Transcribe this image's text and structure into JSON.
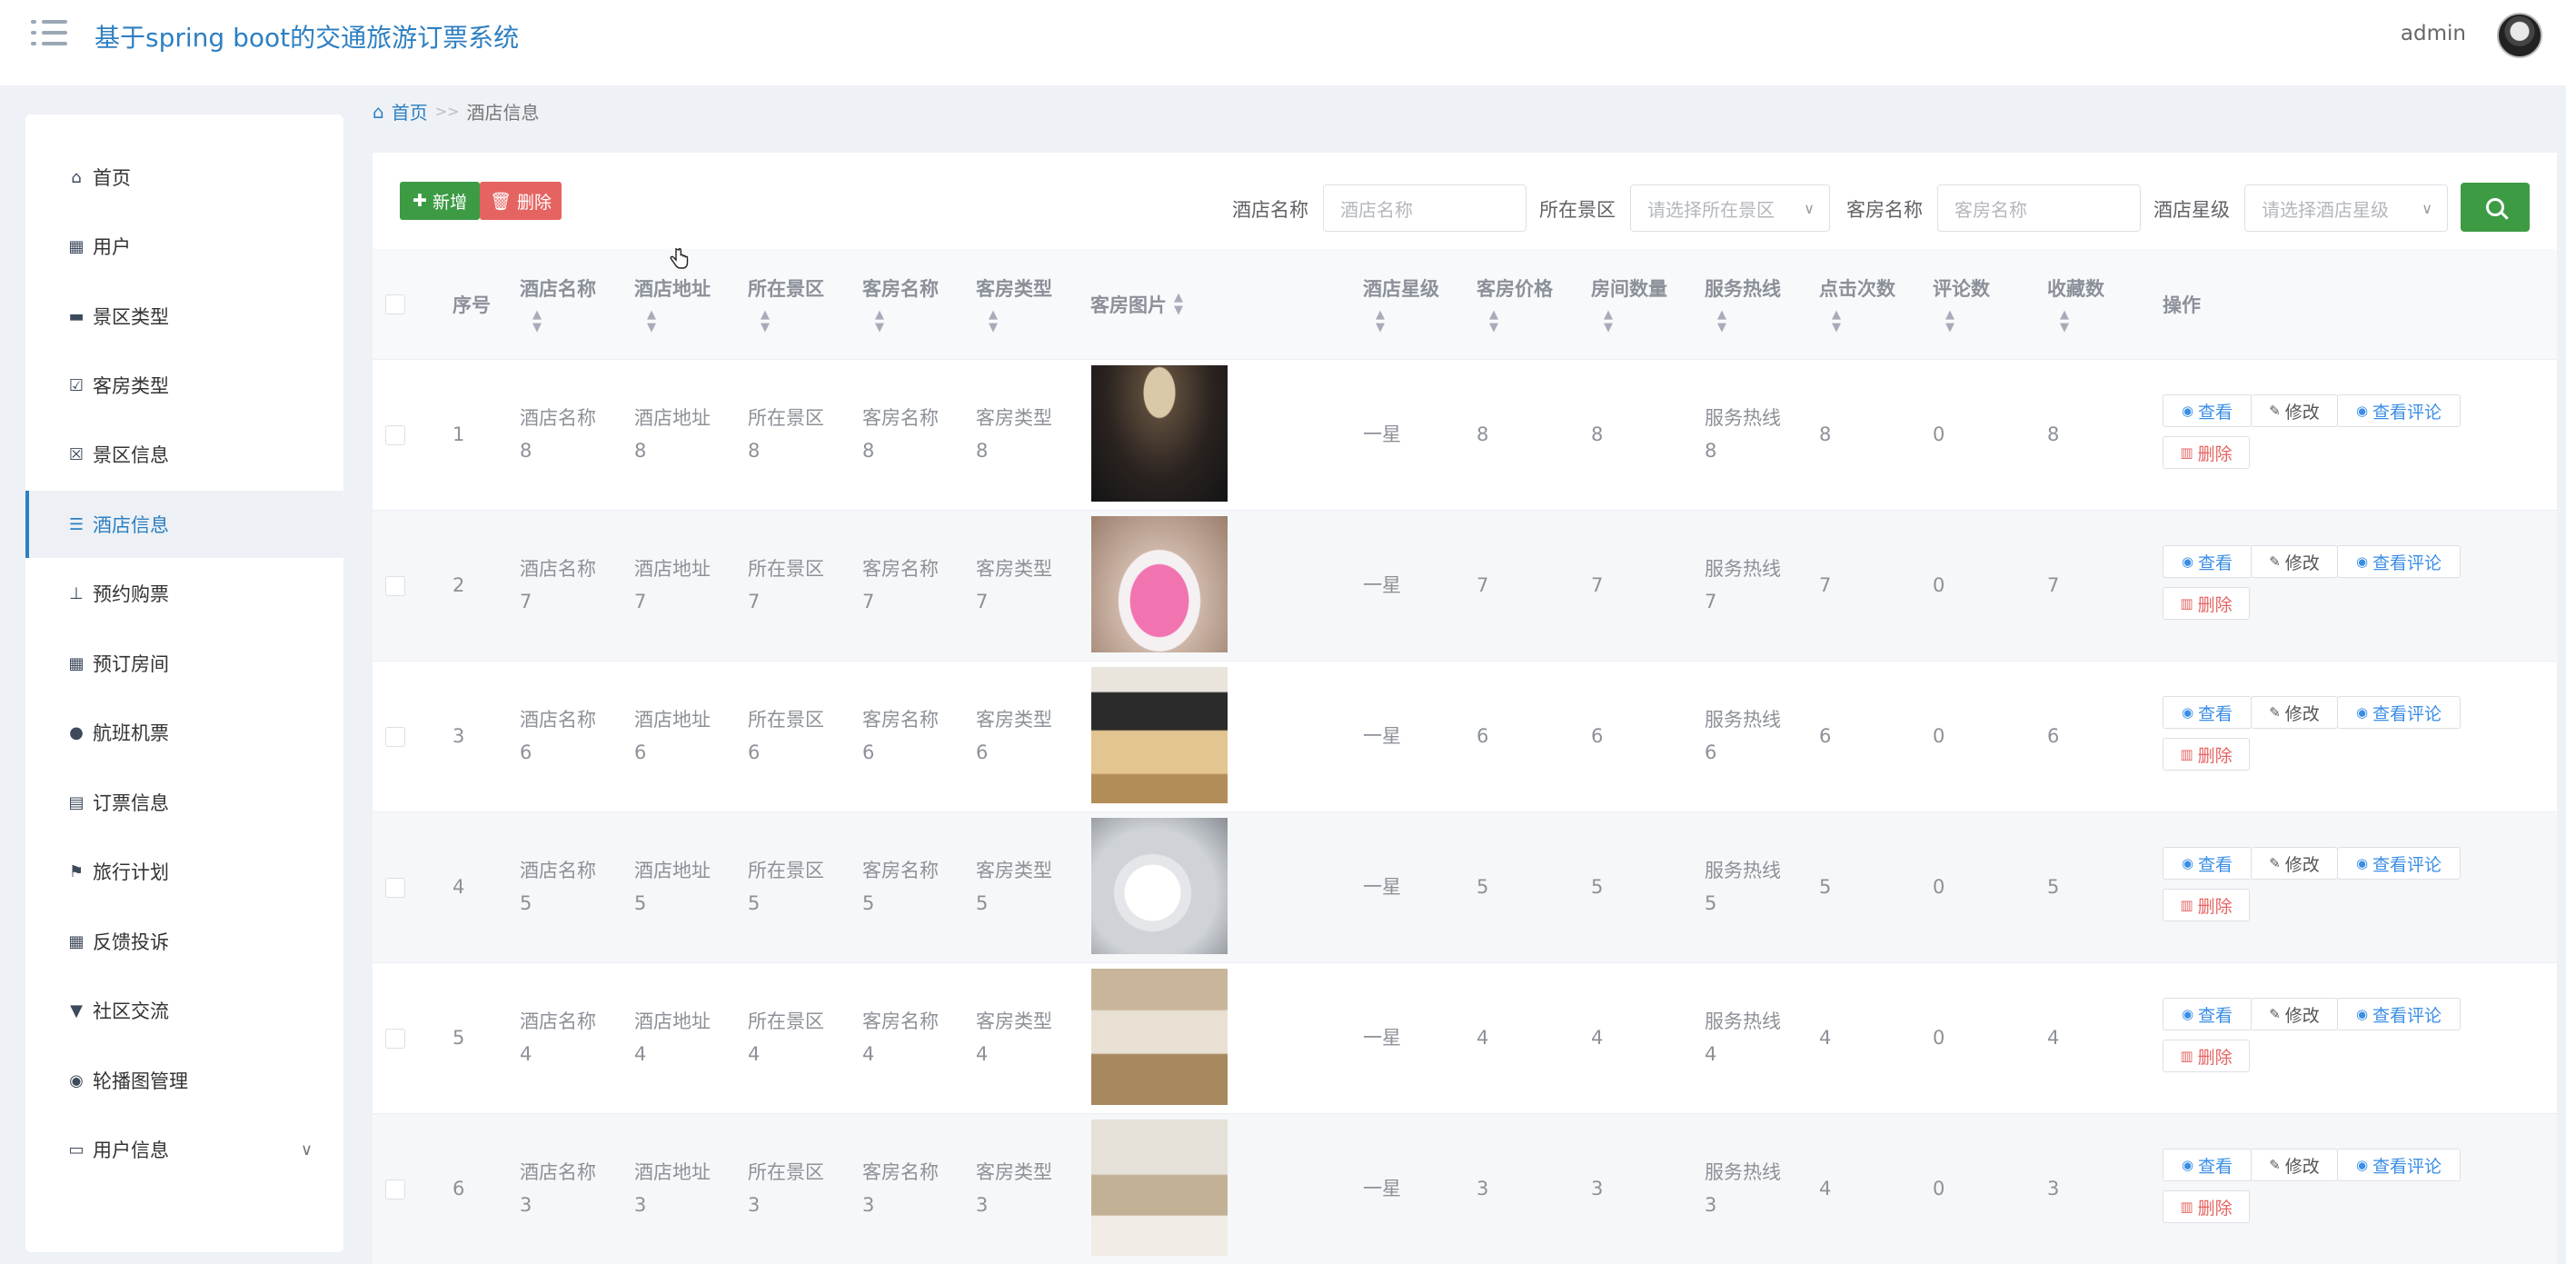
{
  "header": {
    "title": "基于spring boot的交通旅游订票系统",
    "user": "admin"
  },
  "sidebar": {
    "items": [
      {
        "label": "首页",
        "icon": "home-icon"
      },
      {
        "label": "用户",
        "icon": "grid-icon"
      },
      {
        "label": "景区类型",
        "icon": "chat-icon"
      },
      {
        "label": "客房类型",
        "icon": "clipboard-check-icon"
      },
      {
        "label": "景区信息",
        "icon": "clipboard-x-icon"
      },
      {
        "label": "酒店信息",
        "icon": "sliders-icon",
        "active": true
      },
      {
        "label": "预约购票",
        "icon": "stamp-icon"
      },
      {
        "label": "预订房间",
        "icon": "grid-icon"
      },
      {
        "label": "航班机票",
        "icon": "user-icon"
      },
      {
        "label": "订票信息",
        "icon": "clipboard-icon"
      },
      {
        "label": "旅行计划",
        "icon": "flag-icon"
      },
      {
        "label": "反馈投诉",
        "icon": "grid-icon"
      },
      {
        "label": "社区交流",
        "icon": "sign-icon"
      },
      {
        "label": "轮播图管理",
        "icon": "pin-icon"
      },
      {
        "label": "用户信息",
        "icon": "wallet-icon",
        "expandable": true
      }
    ]
  },
  "breadcrumb": {
    "home": "首页",
    "separator": ">>",
    "current": "酒店信息"
  },
  "toolbar": {
    "add_label": "新增",
    "delete_label": "删除"
  },
  "filters": {
    "hotel_name": {
      "label": "酒店名称",
      "placeholder": "酒店名称"
    },
    "scenic_area": {
      "label": "所在景区",
      "placeholder": "请选择所在景区"
    },
    "room_name": {
      "label": "客房名称",
      "placeholder": "客房名称"
    },
    "hotel_star": {
      "label": "酒店星级",
      "placeholder": "请选择酒店星级"
    }
  },
  "table": {
    "columns": {
      "index": "序号",
      "hotel_name": "酒店名称",
      "hotel_address": "酒店地址",
      "scenic_area": "所在景区",
      "room_name": "客房名称",
      "room_type": "客房类型",
      "room_image": "客房图片",
      "hotel_star": "酒店星级",
      "room_price": "客房价格",
      "room_count": "房间数量",
      "service_hotline": "服务热线",
      "clicks": "点击次数",
      "reviews": "评论数",
      "favorites": "收藏数",
      "actions": "操作"
    },
    "rows": [
      {
        "index": "1",
        "name_a": "酒店名称",
        "name_b": "8",
        "addr_a": "酒店地址",
        "addr_b": "8",
        "area_a": "所在景区",
        "area_b": "8",
        "room_a": "客房名称",
        "room_b": "8",
        "type_a": "客房类型",
        "type_b": "8",
        "star": "一星",
        "price": "8",
        "count": "8",
        "hotline_a": "服务热线",
        "hotline_b": "8",
        "clicks": "8",
        "reviews": "0",
        "favorites": "8"
      },
      {
        "index": "2",
        "name_a": "酒店名称",
        "name_b": "7",
        "addr_a": "酒店地址",
        "addr_b": "7",
        "area_a": "所在景区",
        "area_b": "7",
        "room_a": "客房名称",
        "room_b": "7",
        "type_a": "客房类型",
        "type_b": "7",
        "star": "一星",
        "price": "7",
        "count": "7",
        "hotline_a": "服务热线",
        "hotline_b": "7",
        "clicks": "7",
        "reviews": "0",
        "favorites": "7"
      },
      {
        "index": "3",
        "name_a": "酒店名称",
        "name_b": "6",
        "addr_a": "酒店地址",
        "addr_b": "6",
        "area_a": "所在景区",
        "area_b": "6",
        "room_a": "客房名称",
        "room_b": "6",
        "type_a": "客房类型",
        "type_b": "6",
        "star": "一星",
        "price": "6",
        "count": "6",
        "hotline_a": "服务热线",
        "hotline_b": "6",
        "clicks": "6",
        "reviews": "0",
        "favorites": "6"
      },
      {
        "index": "4",
        "name_a": "酒店名称",
        "name_b": "5",
        "addr_a": "酒店地址",
        "addr_b": "5",
        "area_a": "所在景区",
        "area_b": "5",
        "room_a": "客房名称",
        "room_b": "5",
        "type_a": "客房类型",
        "type_b": "5",
        "star": "一星",
        "price": "5",
        "count": "5",
        "hotline_a": "服务热线",
        "hotline_b": "5",
        "clicks": "5",
        "reviews": "0",
        "favorites": "5"
      },
      {
        "index": "5",
        "name_a": "酒店名称",
        "name_b": "4",
        "addr_a": "酒店地址",
        "addr_b": "4",
        "area_a": "所在景区",
        "area_b": "4",
        "room_a": "客房名称",
        "room_b": "4",
        "type_a": "客房类型",
        "type_b": "4",
        "star": "一星",
        "price": "4",
        "count": "4",
        "hotline_a": "服务热线",
        "hotline_b": "4",
        "clicks": "4",
        "reviews": "0",
        "favorites": "4"
      },
      {
        "index": "6",
        "name_a": "酒店名称",
        "name_b": "3",
        "addr_a": "酒店地址",
        "addr_b": "3",
        "area_a": "所在景区",
        "area_b": "3",
        "room_a": "客房名称",
        "room_b": "3",
        "type_a": "客房类型",
        "type_b": "3",
        "star": "一星",
        "price": "3",
        "count": "3",
        "hotline_a": "服务热线",
        "hotline_b": "3",
        "clicks": "4",
        "reviews": "0",
        "favorites": "3"
      }
    ],
    "row_actions": {
      "view": "查看",
      "edit": "修改",
      "view_reviews": "查看评论",
      "delete": "删除"
    }
  },
  "colors": {
    "brand": "#2d7fc1",
    "add_button": "#3d9b44",
    "delete_button": "#e56461"
  }
}
